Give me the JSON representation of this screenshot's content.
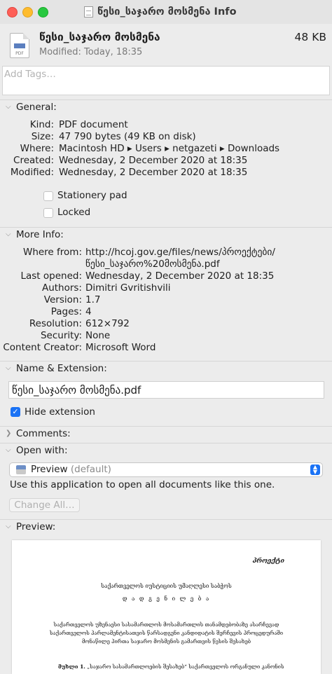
{
  "window": {
    "title": "წესი_საჯარო მოსმენა Info"
  },
  "header": {
    "file_name": "წესი_საჯარო მოსმენა",
    "file_size": "48 KB",
    "modified": "Modified: Today, 18:35",
    "icon": "pdf-document-icon"
  },
  "tags": {
    "placeholder": "Add Tags…"
  },
  "general": {
    "title": "General:",
    "rows": [
      {
        "key": "Kind:",
        "value": "PDF document"
      },
      {
        "key": "Size:",
        "value": "47 790 bytes (49 KB on disk)"
      },
      {
        "key": "Where:",
        "value": "Macintosh HD ▸ Users ▸ netgazeti ▸ Downloads"
      },
      {
        "key": "Created:",
        "value": "Wednesday, 2 December 2020 at 18:35"
      },
      {
        "key": "Modified:",
        "value": "Wednesday, 2 December 2020 at 18:35"
      }
    ],
    "stationery_label": "Stationery pad",
    "stationery_checked": false,
    "locked_label": "Locked",
    "locked_checked": false
  },
  "more_info": {
    "title": "More Info:",
    "rows": [
      {
        "key": "Where from:",
        "value": "http://hcoj.gov.ge/files/news/პროექტები/"
      },
      {
        "key": "",
        "value": "წესი_საჯარო%20მოსმენა.pdf"
      },
      {
        "key": "Last opened:",
        "value": "Wednesday, 2 December 2020 at 18:35"
      },
      {
        "key": "Authors:",
        "value": "Dimitri Gvritishvili"
      },
      {
        "key": "Version:",
        "value": "1.7"
      },
      {
        "key": "Pages:",
        "value": "4"
      },
      {
        "key": "Resolution:",
        "value": "612×792"
      },
      {
        "key": "Security:",
        "value": "None"
      },
      {
        "key": "Content Creator:",
        "value": "Microsoft Word"
      }
    ]
  },
  "name_extension": {
    "title": "Name & Extension:",
    "value": "წესი_საჯარო მოსმენა.pdf",
    "hide_extension_label": "Hide extension",
    "hide_extension_checked": true
  },
  "comments": {
    "title": "Comments:"
  },
  "open_with": {
    "title": "Open with:",
    "app_name": "Preview",
    "app_suffix": "(default)",
    "description": "Use this application to open all documents like this one.",
    "change_all_label": "Change All…"
  },
  "preview": {
    "title": "Preview:",
    "lines": [
      "პროექტი",
      "საქართველოს იუსტიციის უმაღლესი საბჭოს",
      "დ ა დ გ ე ნ ი ლ ე ბ ა",
      "საქართველოს უზენაესი სასამართლოს მოსამართლის თანამდებობაზე ასარჩევად საქართველოს პარლამენტისათვის წარსადგენი კანდიდატის შერჩევის პროცედურაში მონაწილე პირთა საჯარო მოსმენის გამართვის წესის შესახებ",
      "მუხლი 1.",
      " „საჯარო სასამართლოების შესახებ“ საქართველოს ორგანული კანონის"
    ]
  },
  "colors": {
    "accent": "#1a72f5",
    "window_bg": "#ececec",
    "close": "#fe5f57",
    "minimize": "#febc2e",
    "zoom": "#28c840"
  }
}
